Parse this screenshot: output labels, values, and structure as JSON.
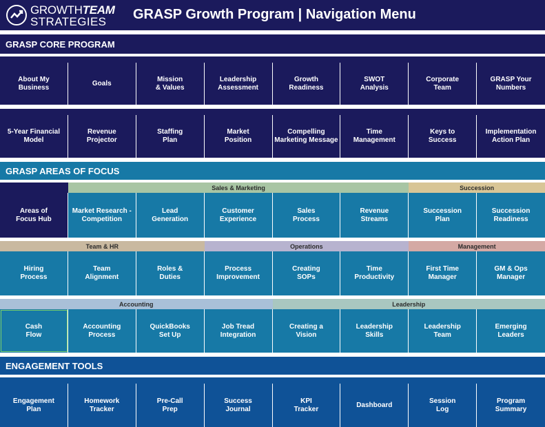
{
  "header": {
    "logo_line1_a": "GROWTH",
    "logo_line1_b": "TEAM",
    "logo_line2": "STRATEGIES",
    "title": "GRASP Growth Program  |  Navigation Menu"
  },
  "core": {
    "heading": "GRASP CORE PROGRAM",
    "row1": [
      "About My\nBusiness",
      "Goals",
      "Mission\n& Values",
      "Leadership\nAssessment",
      "Growth\nReadiness",
      "SWOT\nAnalysis",
      "Corporate\nTeam",
      "GRASP Your\nNumbers"
    ],
    "row2": [
      "5-Year Financial\nModel",
      "Revenue\nProjector",
      "Staffing\nPlan",
      "Market\nPosition",
      "Compelling\nMarketing Message",
      "Time\nManagement",
      "Keys to\nSuccess",
      "Implementation\nAction Plan"
    ]
  },
  "focus": {
    "heading": "GRASP AREAS OF FOCUS",
    "cat1": {
      "sales_marketing": "Sales & Marketing",
      "succession": "Succession"
    },
    "row1": [
      "Areas of\nFocus Hub",
      "Market Research -\nCompetition",
      "Lead\nGeneration",
      "Customer\nExperience",
      "Sales\nProcess",
      "Revenue\nStreams",
      "Succession\nPlan",
      "Succession\nReadiness"
    ],
    "cat2": {
      "team_hr": "Team & HR",
      "operations": "Operations",
      "management": "Management"
    },
    "row2": [
      "Hiring\nProcess",
      "Team\nAlignment",
      "Roles &\nDuties",
      "Process\nImprovement",
      "Creating\nSOPs",
      "Time\nProductivity",
      "First Time\nManager",
      "GM & Ops\nManager"
    ],
    "cat3": {
      "accounting": "Accounting",
      "leadership": "Leadership"
    },
    "row3": [
      "Cash\nFlow",
      "Accounting\nProcess",
      "QuickBooks\nSet Up",
      "Job Tread\nIntegration",
      "Creating a\nVision",
      "Leadership\nSkills",
      "Leadership\nTeam",
      "Emerging\nLeaders"
    ]
  },
  "engagement": {
    "heading": "ENGAGEMENT TOOLS",
    "row": [
      "Engagement\nPlan",
      "Homework\nTracker",
      "Pre-Call\nPrep",
      "Success\nJournal",
      "KPI\nTracker",
      "Dashboard",
      "Session\nLog",
      "Program\nSummary"
    ]
  },
  "colors": {
    "navy": "#1b1a5c",
    "teal": "#1779a6",
    "blue": "#0f5297",
    "sales_marketing": "#a8c5a4",
    "succession": "#d8c596",
    "team_hr": "#c9b9a0",
    "operations": "#b7b3cf",
    "management": "#d4a9a4",
    "accounting": "#a9c0d8",
    "leadership": "#a9c7c0"
  }
}
